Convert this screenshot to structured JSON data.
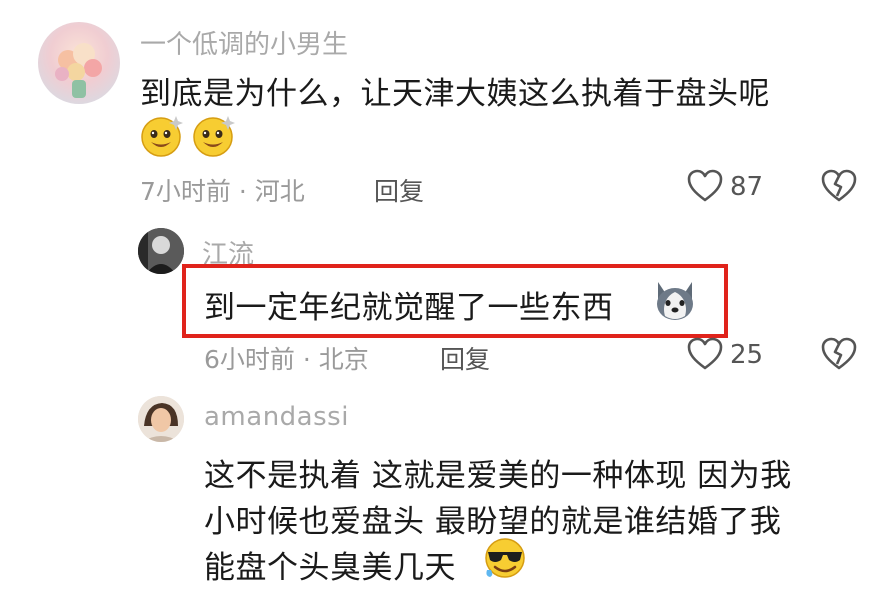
{
  "comments": [
    {
      "username": "一个低调的小男生",
      "text": "到底是为什么，让天津大姨这么执着于盘头呢",
      "emoji": [
        "grinning-sparkle-emoji",
        "grinning-sparkle-emoji"
      ],
      "time_location": "7小时前 · 河北",
      "reply_label": "回复",
      "likes": "87",
      "avatar_icon": "flower-bouquet-avatar"
    },
    {
      "username": "江流",
      "text": "到一定年纪就觉醒了一些东西",
      "emoji": [
        "husky-dog-emoji"
      ],
      "time_location": "6小时前 · 北京",
      "reply_label": "回复",
      "likes": "25",
      "avatar_icon": "bw-portrait-avatar",
      "highlighted": true,
      "highlight_color": "#e0231b"
    },
    {
      "username": "amandassi",
      "text_lines": [
        "这不是执着 这就是爱美的一种体现 因为我",
        "小时候也爱盘头 最盼望的就是谁结婚了我",
        "能盘个头臭美几天"
      ],
      "emoji": [
        "cool-sunglasses-emoji"
      ],
      "avatar_icon": "girl-portrait-avatar"
    }
  ]
}
